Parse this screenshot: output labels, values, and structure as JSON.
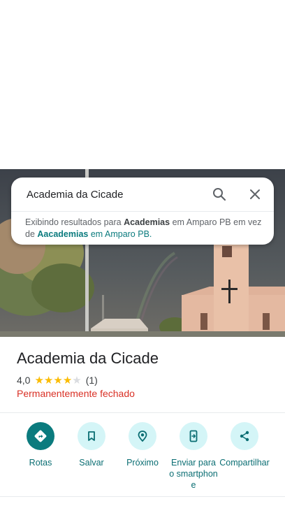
{
  "search": {
    "query": "Academia da Cicade",
    "notice": {
      "prefix": "Exibindo resultados para",
      "shown_term": "Academias",
      "shown_location": "em Amparo PB em vez de",
      "alt_term": "Aacademias",
      "alt_location": "em Amparo PB."
    }
  },
  "place": {
    "name": "Academia da Cicade",
    "rating": "4,0",
    "stars": 4,
    "max_stars": 5,
    "review_count": "(1)",
    "status": "Permanentemente fechado"
  },
  "actions": [
    {
      "label": "Rotas",
      "icon": "directions-icon"
    },
    {
      "label": "Salvar",
      "icon": "bookmark-icon"
    },
    {
      "label": "Próximo",
      "icon": "nearby-icon"
    },
    {
      "label": "Enviar para o smartphone",
      "icon": "send-to-phone-icon"
    },
    {
      "label": "Compartilhar",
      "icon": "share-icon"
    }
  ],
  "colors": {
    "accent": "#0b7b7e",
    "action_bg": "#d4f5f7",
    "closed_status": "#d93025",
    "star": "#fbbc04"
  }
}
